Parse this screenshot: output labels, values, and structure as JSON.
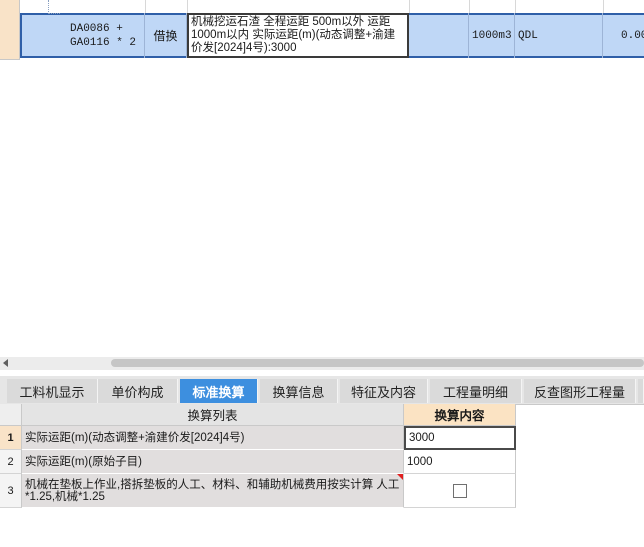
{
  "top_grid": {
    "row": {
      "code_line1": "DA0086 +",
      "code_line2": "GA0116 * 2",
      "type": "借换",
      "name": "机械挖运石渣 全程运距 500m以外 运距1000m以内  实际运距(m)(动态调整+渝建价发[2024]4号):3000",
      "unit": "1000m3",
      "quantity_expr": "QDL",
      "value": "0.00"
    }
  },
  "tabs": [
    {
      "label": "工料机显示",
      "active": false
    },
    {
      "label": "单价构成",
      "active": false
    },
    {
      "label": "标准换算",
      "active": true
    },
    {
      "label": "换算信息",
      "active": false
    },
    {
      "label": "特征及内容",
      "active": false
    },
    {
      "label": "工程量明细",
      "active": false
    },
    {
      "label": "反查图形工程量",
      "active": false
    }
  ],
  "conversion_table": {
    "header_list": "换算列表",
    "header_content": "换算内容",
    "rows": [
      {
        "num": "1",
        "desc": "实际运距(m)(动态调整+渝建价发[2024]4号)",
        "value": "3000"
      },
      {
        "num": "2",
        "desc": "实际运距(m)(原始子目)",
        "value": "1000"
      },
      {
        "num": "3",
        "desc": "机械在垫板上作业,搭拆垫板的人工、材料、和辅助机械费用按实计算 人工*1.25,机械*1.25",
        "value": "",
        "checked": false
      }
    ]
  }
}
